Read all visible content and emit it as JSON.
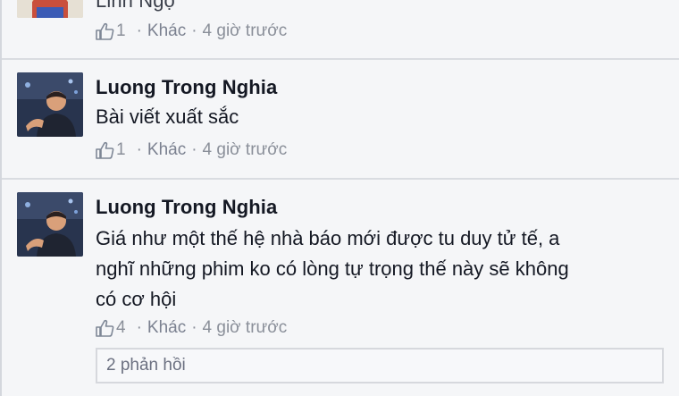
{
  "comments": [
    {
      "author": "Linh Ngọ",
      "text": "",
      "likes": "1",
      "other_label": "Khác",
      "time": "4 giờ trước"
    },
    {
      "author": "Luong Trong Nghia",
      "text": "Bài viết xuất sắc",
      "likes": "1",
      "other_label": "Khác",
      "time": "4 giờ trước"
    },
    {
      "author": "Luong Trong Nghia",
      "text_lines": [
        "Giá như một thế hệ nhà báo mới được tu duy tử tế, a",
        "nghĩ những phim ko có lòng tự trọng thế này sẽ không",
        "có cơ hội"
      ],
      "likes": "4",
      "other_label": "Khác",
      "time": "4 giờ trước",
      "replies_label": "2 phản hồi"
    }
  ],
  "separator": "·",
  "icons": {
    "like": "thumbs-up-icon"
  },
  "colors": {
    "background": "#f5f6f8",
    "author": "#141823",
    "meta": "#8a8f99",
    "divider": "#d9dce1"
  }
}
